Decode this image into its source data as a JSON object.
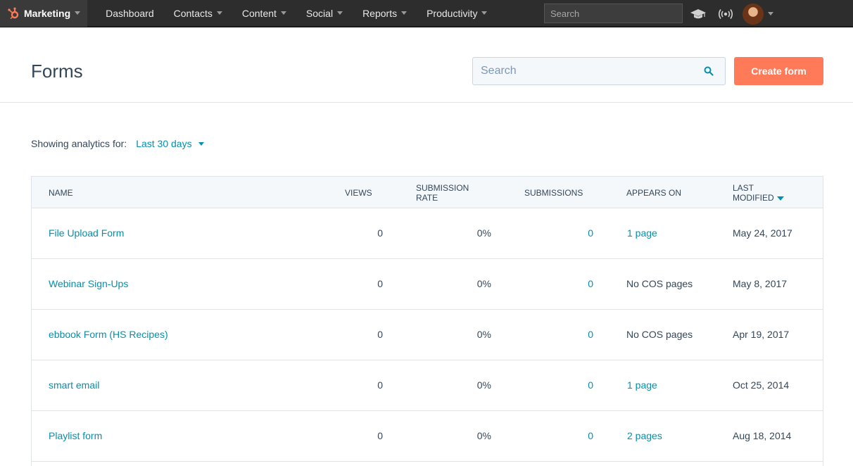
{
  "nav": {
    "brand": "Marketing",
    "items": [
      "Dashboard",
      "Contacts",
      "Content",
      "Social",
      "Reports",
      "Productivity"
    ],
    "search_placeholder": "Search"
  },
  "header": {
    "title": "Forms",
    "search_placeholder": "Search",
    "create_label": "Create form"
  },
  "analytics": {
    "label": "Showing analytics for:",
    "range": "Last 30 days"
  },
  "table": {
    "headers": {
      "name": "NAME",
      "views": "VIEWS",
      "submission_rate_1": "SUBMISSION",
      "submission_rate_2": "RATE",
      "submissions": "SUBMISSIONS",
      "appears_on": "APPEARS ON",
      "last_modified_1": "LAST",
      "last_modified_2": "MODIFIED"
    },
    "rows": [
      {
        "name": "File Upload Form",
        "views": "0",
        "rate": "0%",
        "submissions": "0",
        "appears_on": "1 page",
        "appears_link": true,
        "modified": "May 24, 2017"
      },
      {
        "name": "Webinar Sign-Ups",
        "views": "0",
        "rate": "0%",
        "submissions": "0",
        "appears_on": "No COS pages",
        "appears_link": false,
        "modified": "May 8, 2017"
      },
      {
        "name": "ebbook Form (HS Recipes)",
        "views": "0",
        "rate": "0%",
        "submissions": "0",
        "appears_on": "No COS pages",
        "appears_link": false,
        "modified": "Apr 19, 2017"
      },
      {
        "name": "smart email",
        "views": "0",
        "rate": "0%",
        "submissions": "0",
        "appears_on": "1 page",
        "appears_link": true,
        "modified": "Oct 25, 2014"
      },
      {
        "name": "Playlist form",
        "views": "0",
        "rate": "0%",
        "submissions": "0",
        "appears_on": "2 pages",
        "appears_link": true,
        "modified": "Aug 18, 2014"
      }
    ]
  },
  "colors": {
    "accent": "#0091ae",
    "cta": "#ff7a59",
    "nav_bg": "#2d2d2d",
    "text": "#33475b"
  },
  "icons": {
    "brand": "hubspot-sprocket-icon",
    "academy": "graduation-cap-icon",
    "notifications": "broadcast-icon",
    "search": "search-icon"
  }
}
